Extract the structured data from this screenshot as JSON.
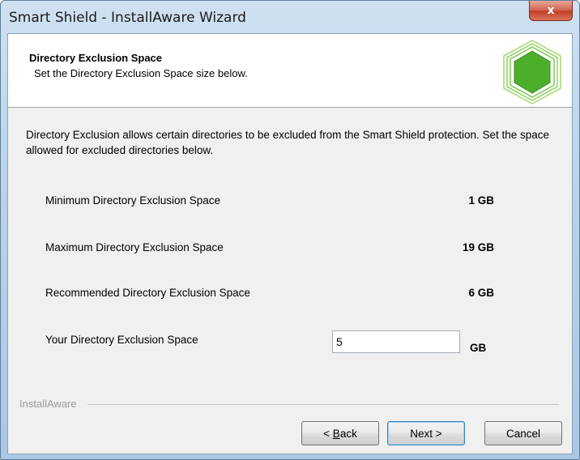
{
  "window": {
    "title": "Smart Shield - InstallAware Wizard",
    "close_glyph": "x"
  },
  "header": {
    "title": "Directory Exclusion Space",
    "subtitle": "Set the Directory Exclusion Space size below.",
    "logo_icon": "green-hexagon-shield-icon"
  },
  "description": "Directory Exclusion allows certain directories to be excluded from the Smart Shield protection. Set the space allowed for excluded directories below.",
  "rows": [
    {
      "label": "Minimum Directory Exclusion Space",
      "value": "1 GB"
    },
    {
      "label": "Maximum Directory Exclusion Space",
      "value": "19 GB"
    },
    {
      "label": "Recommended Directory Exclusion Space",
      "value": "6 GB"
    }
  ],
  "your_space": {
    "label": "Your Directory Exclusion Space",
    "value": "5",
    "unit": "GB"
  },
  "footer": {
    "group_label": "InstallAware",
    "back_prefix": "< ",
    "back_mnemonic": "B",
    "back_rest": "ack",
    "next_label": "Next >",
    "cancel_label": "Cancel"
  },
  "colors": {
    "logo_green": "#4caf2a",
    "logo_outline": "#8fd060",
    "close_red": "#c2412b"
  }
}
